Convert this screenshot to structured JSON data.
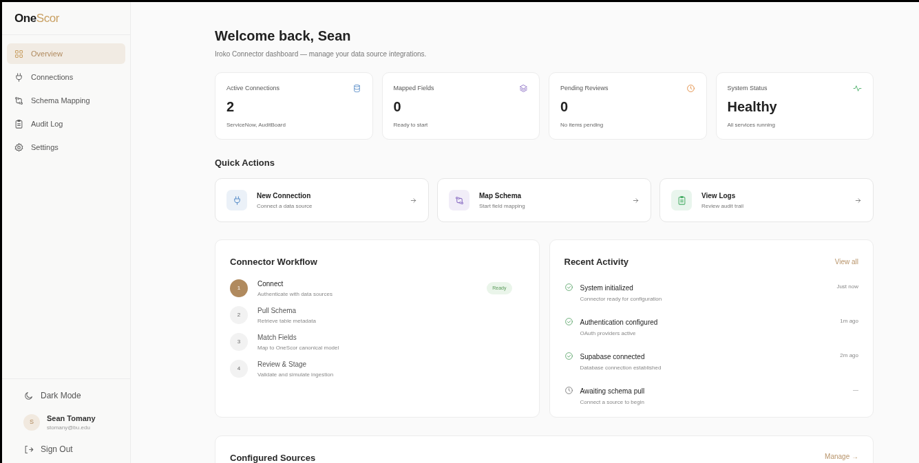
{
  "logo": {
    "part1": "One",
    "part2": "Scor"
  },
  "nav": [
    {
      "label": "Overview",
      "selected": true
    },
    {
      "label": "Connections",
      "selected": false
    },
    {
      "label": "Schema Mapping",
      "selected": false
    },
    {
      "label": "Audit Log",
      "selected": false
    },
    {
      "label": "Settings",
      "selected": false
    }
  ],
  "dark_mode": {
    "label": "Dark Mode"
  },
  "user": {
    "initial": "S",
    "name": "Sean Tomany",
    "email": "stomany@bu.edu"
  },
  "sign_out": {
    "label": "Sign Out"
  },
  "header": {
    "title": "Welcome back, Sean",
    "subtitle": "Iroko Connector dashboard — manage your data source integrations."
  },
  "stats": [
    {
      "label": "Active Connections",
      "value": "2",
      "note": "ServiceNow, AuditBoard"
    },
    {
      "label": "Mapped Fields",
      "value": "0",
      "note": "Ready to start"
    },
    {
      "label": "Pending Reviews",
      "value": "0",
      "note": "No items pending"
    },
    {
      "label": "System Status",
      "value": "Healthy",
      "note": "All services running"
    }
  ],
  "quick_actions": {
    "title": "Quick Actions",
    "items": [
      {
        "title": "New Connection",
        "subtitle": "Connect a data source"
      },
      {
        "title": "Map Schema",
        "subtitle": "Start field mapping"
      },
      {
        "title": "View Logs",
        "subtitle": "Review audit trail"
      }
    ]
  },
  "workflow": {
    "title": "Connector Workflow",
    "steps": [
      {
        "number": "1",
        "title": "Connect",
        "subtitle": "Authenticate with data sources",
        "active": true,
        "badge": "Ready"
      },
      {
        "number": "2",
        "title": "Pull Schema",
        "subtitle": "Retrieve table metadata",
        "active": false
      },
      {
        "number": "3",
        "title": "Match Fields",
        "subtitle": "Map to OneScor canonical model",
        "active": false
      },
      {
        "number": "4",
        "title": "Review & Stage",
        "subtitle": "Validate and simulate ingestion",
        "active": false
      }
    ]
  },
  "activity": {
    "title": "Recent Activity",
    "link": "View all",
    "items": [
      {
        "title": "System initialized",
        "subtitle": "Connector ready for configuration",
        "time": "Just now",
        "kind": "done"
      },
      {
        "title": "Authentication configured",
        "subtitle": "OAuth providers active",
        "time": "1m ago",
        "kind": "done"
      },
      {
        "title": "Supabase connected",
        "subtitle": "Database connection established",
        "time": "2m ago",
        "kind": "done"
      },
      {
        "title": "Awaiting schema pull",
        "subtitle": "Connect a source to begin",
        "time": "—",
        "kind": "pending"
      }
    ]
  },
  "sources": {
    "title": "Configured Sources",
    "link": "Manage →"
  }
}
